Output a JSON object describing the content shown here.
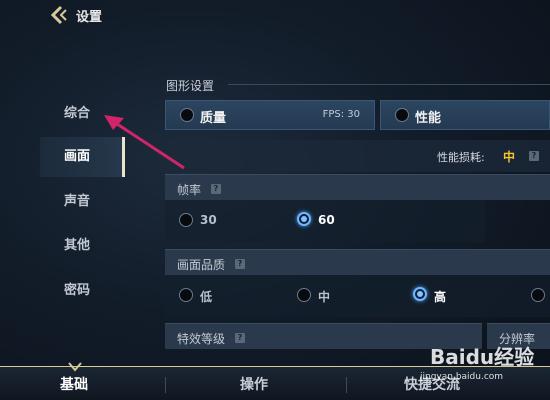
{
  "header": {
    "title": "设置"
  },
  "nav": {
    "items": [
      {
        "label": "综合"
      },
      {
        "label": "画面"
      },
      {
        "label": "声音"
      },
      {
        "label": "其他"
      },
      {
        "label": "密码"
      }
    ],
    "active": "画面"
  },
  "graphics": {
    "section_title": "图形设置",
    "modes": [
      {
        "label": "质量",
        "fps": "FPS: 30",
        "selected": false
      },
      {
        "label": "性能",
        "fps": "",
        "selected": false
      }
    ],
    "perf_cost_label": "性能损耗:",
    "perf_cost_value": "中",
    "help_glyph": "?",
    "framerate": {
      "label": "帧率",
      "options": [
        "30",
        "60"
      ],
      "selected": "60"
    },
    "quality": {
      "label": "画面品质",
      "options": [
        "低",
        "中",
        "高"
      ],
      "selected": "高"
    },
    "effects": {
      "label": "特效等级"
    },
    "resolution": {
      "label": "分辨率"
    }
  },
  "bottom_tabs": [
    {
      "label": "基础",
      "active": true
    },
    {
      "label": "操作",
      "active": false
    },
    {
      "label": "快捷交流",
      "active": false
    }
  ],
  "watermark": {
    "text": "Baidu经验",
    "url": "jingyan.baidu.com"
  },
  "colors": {
    "accent_gold": "#f4c430",
    "arrow": "#d0256a",
    "selected_radio": "#6fb6ff"
  }
}
